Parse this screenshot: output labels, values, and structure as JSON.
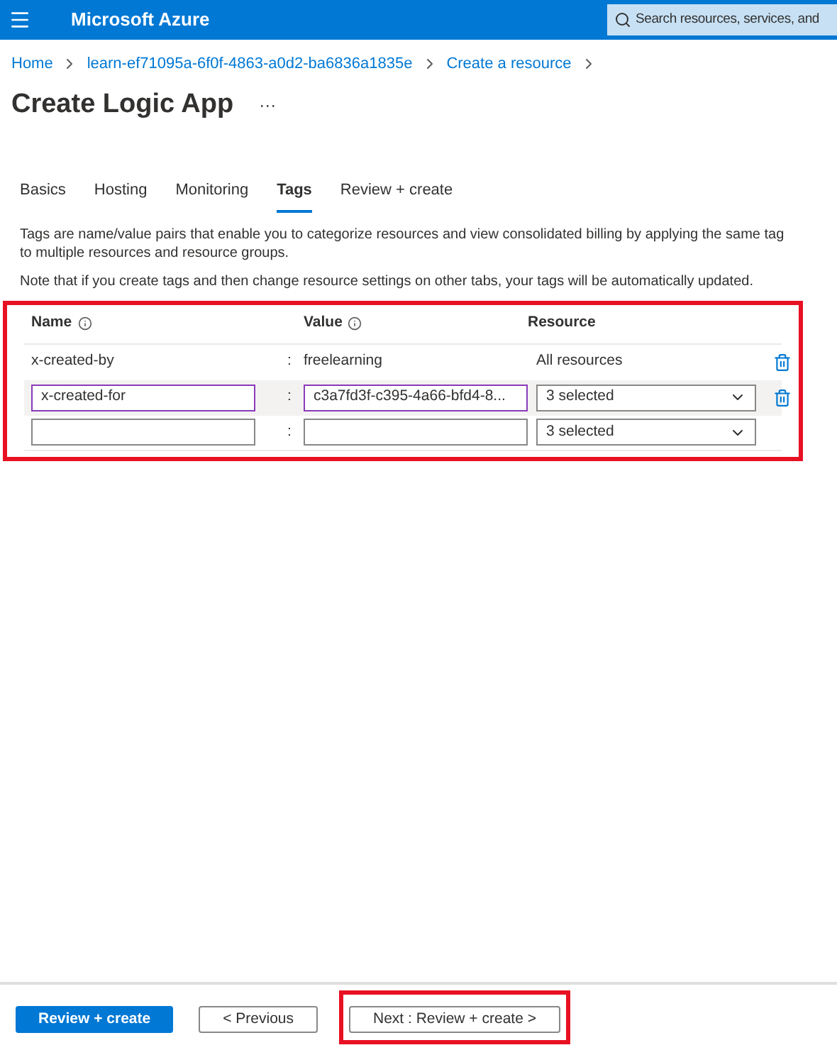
{
  "header": {
    "brand": "Microsoft Azure",
    "search": {
      "placeholder": "Search resources, services, and"
    }
  },
  "breadcrumb": [
    "Home",
    "learn-ef71095a-6f0f-4863-a0d2-ba6836a1835e",
    "Create a resource"
  ],
  "title": "Create Logic App",
  "more": "···",
  "tabs": [
    {
      "label": "Basics",
      "selected": false
    },
    {
      "label": "Hosting",
      "selected": false
    },
    {
      "label": "Monitoring",
      "selected": false
    },
    {
      "label": "Tags",
      "selected": true
    },
    {
      "label": "Review + create",
      "selected": false
    }
  ],
  "description": "Tags are name/value pairs that enable you to categorize resources and view consolidated billing by applying the same tag to multiple resources and resource groups.",
  "note": "Note that if you create tags and then change resource settings on other tabs, your tags will be automatically updated.",
  "table": {
    "annotated": true,
    "columns": [
      "Name",
      "Value",
      "Resource"
    ],
    "rows": [
      {
        "kind": "static",
        "name": "x-created-by",
        "separator": ":",
        "value": "freelearning",
        "resource": "All resources",
        "selected": false,
        "deletable": true
      },
      {
        "kind": "editable",
        "name": "x-created-for",
        "separator": ":",
        "value": "c3a7fd3f-c395-4a66-bfd4-8...",
        "resource": "3 selected",
        "selected": true,
        "deletable": true
      },
      {
        "kind": "editable",
        "separator": ":",
        "resource": "3 selected",
        "selected": false,
        "deletable": false
      }
    ]
  },
  "footer": {
    "buttons": [
      {
        "label": "Review + create",
        "kind": "primary",
        "annotated": false
      },
      {
        "label": "< Previous",
        "kind": "secondary",
        "annotated": false
      },
      {
        "label": "Next : Review + create >",
        "kind": "secondary",
        "annotated": true
      }
    ]
  }
}
